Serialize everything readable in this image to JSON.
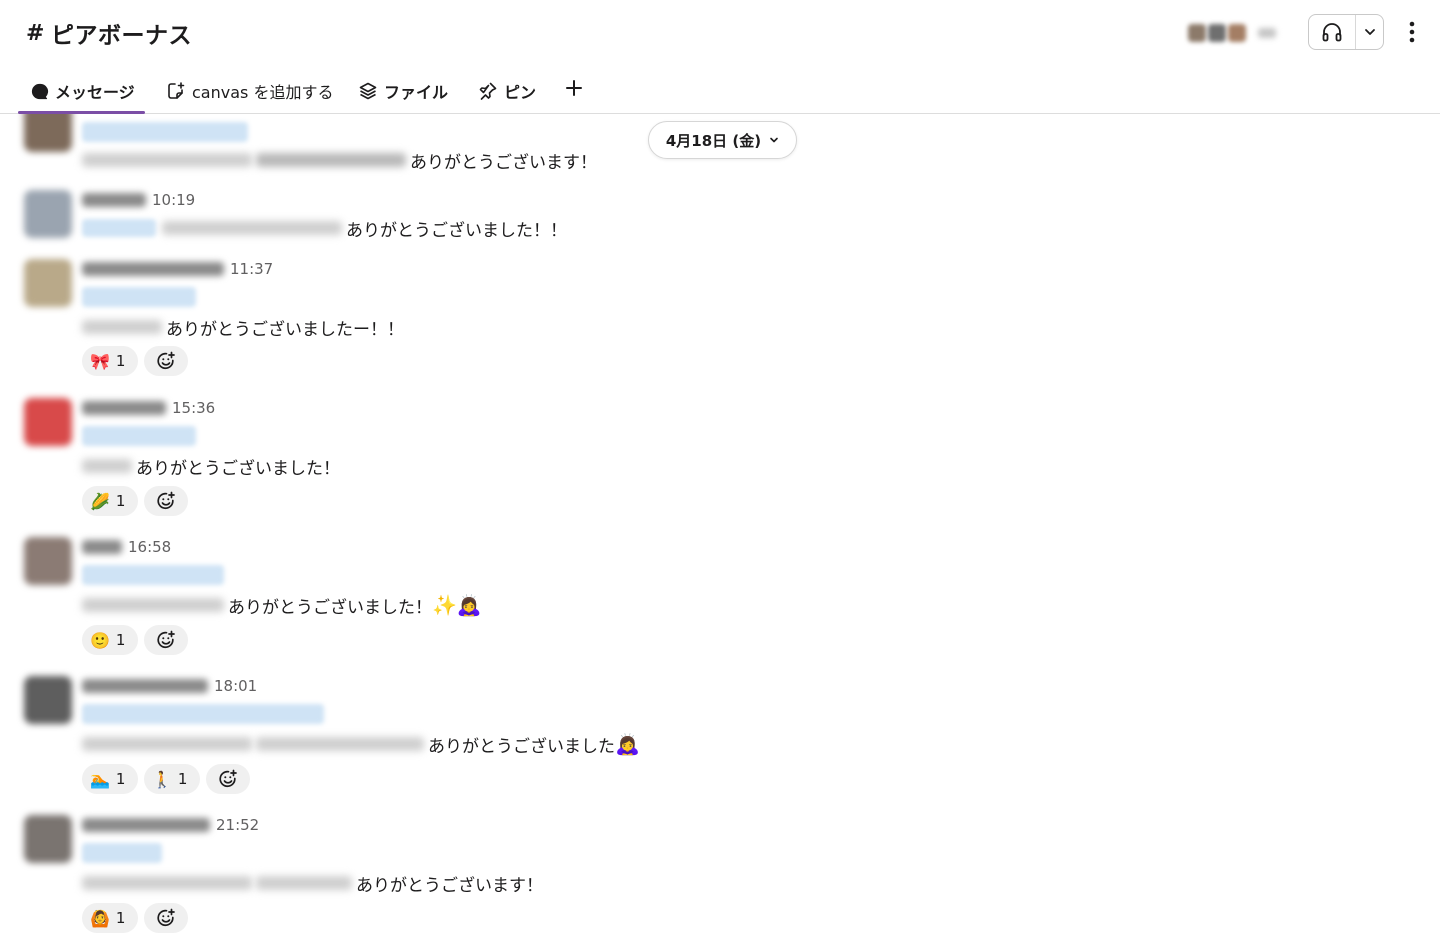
{
  "channel": {
    "hash": "#",
    "name": "ピアボーナス"
  },
  "tabs": [
    {
      "label": "メッセージ",
      "icon": "message-bubble-icon",
      "active": true
    },
    {
      "label": "canvas を追加する",
      "icon": "canvas-add-icon",
      "active": false
    },
    {
      "label": "ファイル",
      "icon": "layers-icon",
      "active": false
    },
    {
      "label": "ピン",
      "icon": "pin-icon",
      "active": false
    }
  ],
  "date_divider": {
    "label": "4月18日 (金)"
  },
  "messages": [
    {
      "time": "",
      "text": "ありがとうございます！",
      "emojis": "",
      "reactions": []
    },
    {
      "time": "10:19",
      "text": "ありがとうございました！！",
      "emojis": "",
      "reactions": []
    },
    {
      "time": "11:37",
      "text": "ありがとうございましたー！！",
      "emojis": "",
      "reactions": [
        {
          "emoji": "🎀",
          "count": "1"
        }
      ]
    },
    {
      "time": "15:36",
      "text": "ありがとうございました！",
      "emojis": "",
      "reactions": [
        {
          "emoji": "🌽",
          "count": "1"
        }
      ]
    },
    {
      "time": "16:58",
      "text": "ありがとうございました！",
      "emojis": "✨🙇‍♀️",
      "reactions": [
        {
          "emoji": "🙂",
          "count": "1"
        }
      ]
    },
    {
      "time": "18:01",
      "text": "ありがとうございました",
      "emojis": "🙇‍♀️",
      "reactions": [
        {
          "emoji": "🏊",
          "count": "1"
        },
        {
          "emoji": "🚶",
          "count": "1"
        }
      ]
    },
    {
      "time": "21:52",
      "text": "ありがとうございます！",
      "emojis": "",
      "reactions": [
        {
          "emoji": "🙆",
          "count": "1"
        }
      ]
    }
  ],
  "colors": {
    "accent_tab_underline": "#7b4ea6",
    "mention_bg": "#cfe3f5",
    "reaction_bg": "#f0f0f0",
    "text": "#1d1c1d",
    "muted_text": "#616061"
  },
  "icons": {
    "huddle": "headphones-icon",
    "huddle_menu": "chevron-down-icon",
    "more": "kebab-menu-icon",
    "add_tab": "plus-icon",
    "add_reaction": "add-emoji-icon"
  }
}
